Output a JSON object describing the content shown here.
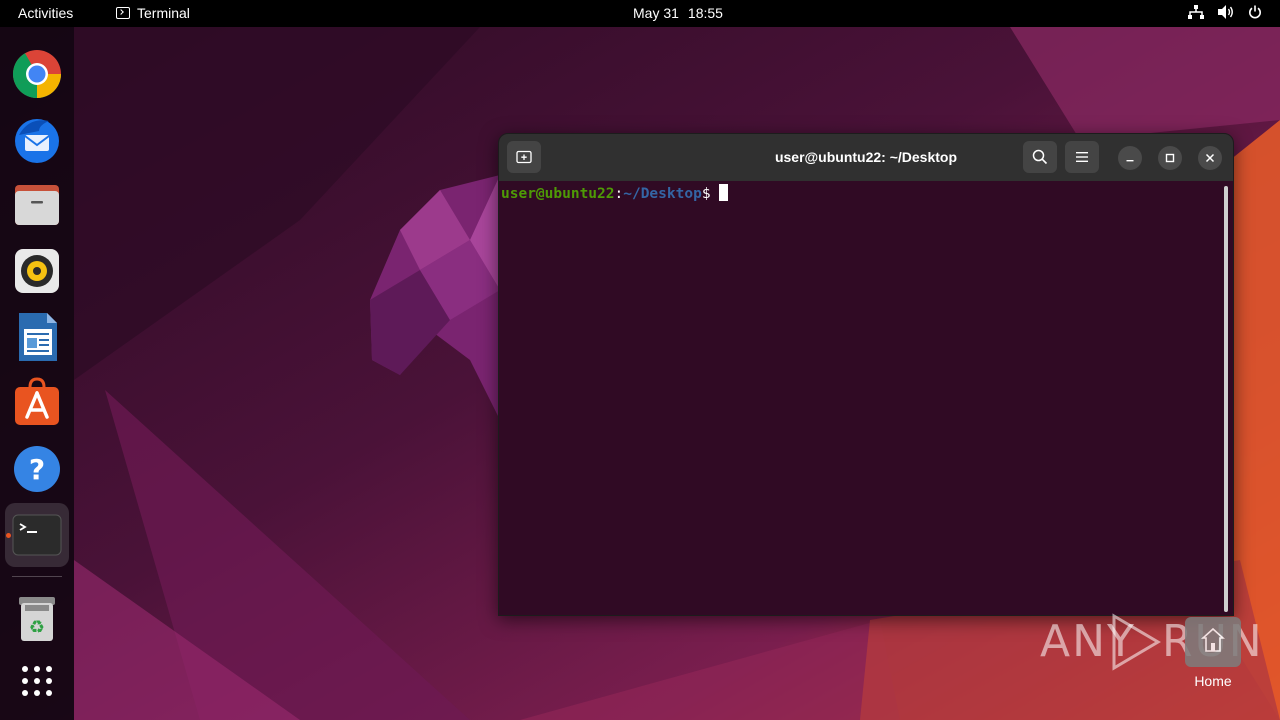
{
  "topbar": {
    "activities": "Activities",
    "app_name": "Terminal",
    "date": "May 31",
    "time": "18:55",
    "tray_icons": [
      "network-icon",
      "volume-icon",
      "power-icon"
    ]
  },
  "dock": {
    "apps": [
      {
        "name": "Google Chrome",
        "icon": "chrome-icon"
      },
      {
        "name": "Thunderbird Mail",
        "icon": "thunderbird-icon"
      },
      {
        "name": "Files",
        "icon": "files-icon"
      },
      {
        "name": "Rhythmbox",
        "icon": "rhythmbox-icon"
      },
      {
        "name": "LibreOffice Writer",
        "icon": "writer-icon"
      },
      {
        "name": "Ubuntu Software",
        "icon": "software-icon"
      },
      {
        "name": "Help",
        "icon": "help-icon"
      },
      {
        "name": "Terminal",
        "icon": "terminal-icon",
        "running": true
      },
      {
        "name": "Trash",
        "icon": "trash-icon"
      },
      {
        "name": "Show Applications",
        "icon": "app-grid-icon"
      }
    ]
  },
  "terminal": {
    "title": "user@ubuntu22: ~/Desktop",
    "prompt_user": "user@ubuntu22",
    "prompt_colon": ":",
    "prompt_path": "~/Desktop",
    "prompt_symbol": "$"
  },
  "desktop": {
    "home_label": "Home"
  },
  "watermark": {
    "left": "ANY",
    "right": "RUN"
  },
  "colors": {
    "accent": "#e95420",
    "terminal_bg": "#300a24",
    "prompt_user": "#4e9a06",
    "prompt_path": "#3465a4"
  }
}
